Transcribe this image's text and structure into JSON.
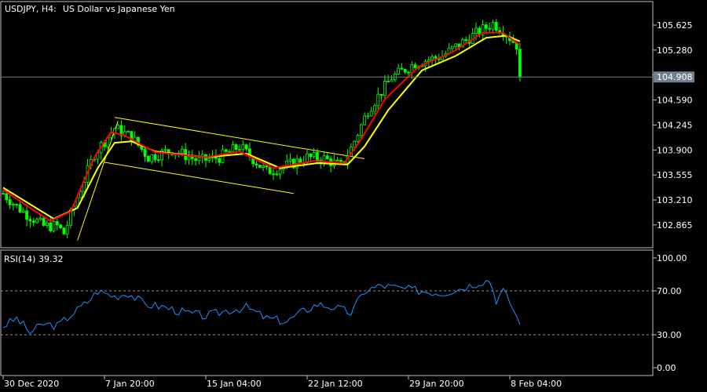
{
  "header": {
    "symbol": "USDJPY, H4:",
    "description": "US Dollar vs Japanese Yen"
  },
  "rsi_header": "RSI(14) 39.32",
  "current_price_label": "104.908",
  "colors": {
    "background": "#000000",
    "frame": "#c0c0c0",
    "candles": "#00ff00",
    "ma_fast": "#ff0000",
    "ma_slow": "#ffff00",
    "channel": "#ffff00",
    "rsi_line": "#1e90ff",
    "price_line": "#708090",
    "price_tag_bg": "#708090"
  },
  "chart_data": [
    {
      "type": "candlestick",
      "title": "USDJPY, H4:  US Dollar vs Japanese Yen",
      "ylim": [
        102.55,
        105.95
      ],
      "y_ticks": [
        "105.625",
        "105.280",
        "104.935",
        "104.590",
        "104.245",
        "103.900",
        "103.555",
        "103.210",
        "102.865"
      ],
      "x_ticks": [
        "30 Dec 2020",
        "7 Jan 20:00",
        "15 Jan 04:00",
        "22 Jan 12:00",
        "29 Jan 20:00",
        "8 Feb 04:00"
      ],
      "last_price": 104.908,
      "close_path": [
        [
          0,
          103.3
        ],
        [
          4,
          103.12
        ],
        [
          8,
          102.98
        ],
        [
          12,
          102.85
        ],
        [
          16,
          102.85
        ],
        [
          18,
          102.75
        ],
        [
          22,
          103.25
        ],
        [
          27,
          103.85
        ],
        [
          33,
          104.2
        ],
        [
          38,
          104.08
        ],
        [
          43,
          103.8
        ],
        [
          50,
          103.9
        ],
        [
          58,
          103.75
        ],
        [
          64,
          103.8
        ],
        [
          70,
          103.95
        ],
        [
          78,
          103.6
        ],
        [
          85,
          103.7
        ],
        [
          90,
          103.8
        ],
        [
          95,
          103.78
        ],
        [
          100,
          103.68
        ],
        [
          103,
          103.92
        ],
        [
          108,
          104.45
        ],
        [
          115,
          104.9
        ],
        [
          122,
          105.1
        ],
        [
          130,
          105.2
        ],
        [
          138,
          105.45
        ],
        [
          145,
          105.65
        ],
        [
          148,
          105.55
        ],
        [
          152,
          105.35
        ],
        [
          153,
          104.91
        ]
      ],
      "ma_fast_path": [
        [
          0,
          103.35
        ],
        [
          8,
          103.1
        ],
        [
          14,
          102.92
        ],
        [
          20,
          103.05
        ],
        [
          27,
          103.8
        ],
        [
          32,
          104.15
        ],
        [
          36,
          104.1
        ],
        [
          45,
          103.87
        ],
        [
          60,
          103.8
        ],
        [
          70,
          103.88
        ],
        [
          80,
          103.65
        ],
        [
          92,
          103.75
        ],
        [
          101,
          103.72
        ],
        [
          106,
          104.05
        ],
        [
          113,
          104.6
        ],
        [
          123,
          105.05
        ],
        [
          133,
          105.25
        ],
        [
          142,
          105.52
        ],
        [
          148,
          105.52
        ],
        [
          153,
          105.35
        ]
      ],
      "ma_slow_path": [
        [
          0,
          103.38
        ],
        [
          8,
          103.15
        ],
        [
          15,
          102.95
        ],
        [
          22,
          103.1
        ],
        [
          28,
          103.65
        ],
        [
          33,
          104.0
        ],
        [
          38,
          104.02
        ],
        [
          45,
          103.88
        ],
        [
          60,
          103.8
        ],
        [
          72,
          103.85
        ],
        [
          82,
          103.65
        ],
        [
          93,
          103.72
        ],
        [
          102,
          103.7
        ],
        [
          107,
          103.95
        ],
        [
          114,
          104.45
        ],
        [
          124,
          105.0
        ],
        [
          134,
          105.2
        ],
        [
          143,
          105.45
        ],
        [
          149,
          105.48
        ],
        [
          153,
          105.4
        ]
      ],
      "channel": {
        "upper": [
          [
            33,
            104.35
          ],
          [
            107,
            103.78
          ]
        ],
        "lower": [
          [
            30,
            103.73
          ],
          [
            86,
            103.3
          ]
        ],
        "trend": [
          [
            22,
            102.65
          ],
          [
            34,
            104.3
          ]
        ]
      }
    },
    {
      "type": "line",
      "title": "RSI(14) 39.32",
      "ylim": [
        0,
        100
      ],
      "y_ticks": [
        "100.00",
        "70.00",
        "30.00",
        "0.00"
      ],
      "levels": [
        70,
        30
      ],
      "rsi_path": [
        [
          0,
          38
        ],
        [
          4,
          45
        ],
        [
          8,
          32
        ],
        [
          12,
          40
        ],
        [
          16,
          38
        ],
        [
          20,
          48
        ],
        [
          25,
          60
        ],
        [
          28,
          70
        ],
        [
          33,
          65
        ],
        [
          37,
          68
        ],
        [
          42,
          58
        ],
        [
          48,
          55
        ],
        [
          54,
          50
        ],
        [
          60,
          47
        ],
        [
          66,
          52
        ],
        [
          72,
          55
        ],
        [
          78,
          45
        ],
        [
          84,
          42
        ],
        [
          88,
          50
        ],
        [
          93,
          58
        ],
        [
          98,
          55
        ],
        [
          103,
          50
        ],
        [
          107,
          70
        ],
        [
          112,
          75
        ],
        [
          118,
          72
        ],
        [
          124,
          70
        ],
        [
          130,
          68
        ],
        [
          136,
          73
        ],
        [
          141,
          78
        ],
        [
          144,
          80
        ],
        [
          146,
          62
        ],
        [
          148,
          70
        ],
        [
          150,
          60
        ],
        [
          153,
          39.32
        ]
      ]
    }
  ]
}
